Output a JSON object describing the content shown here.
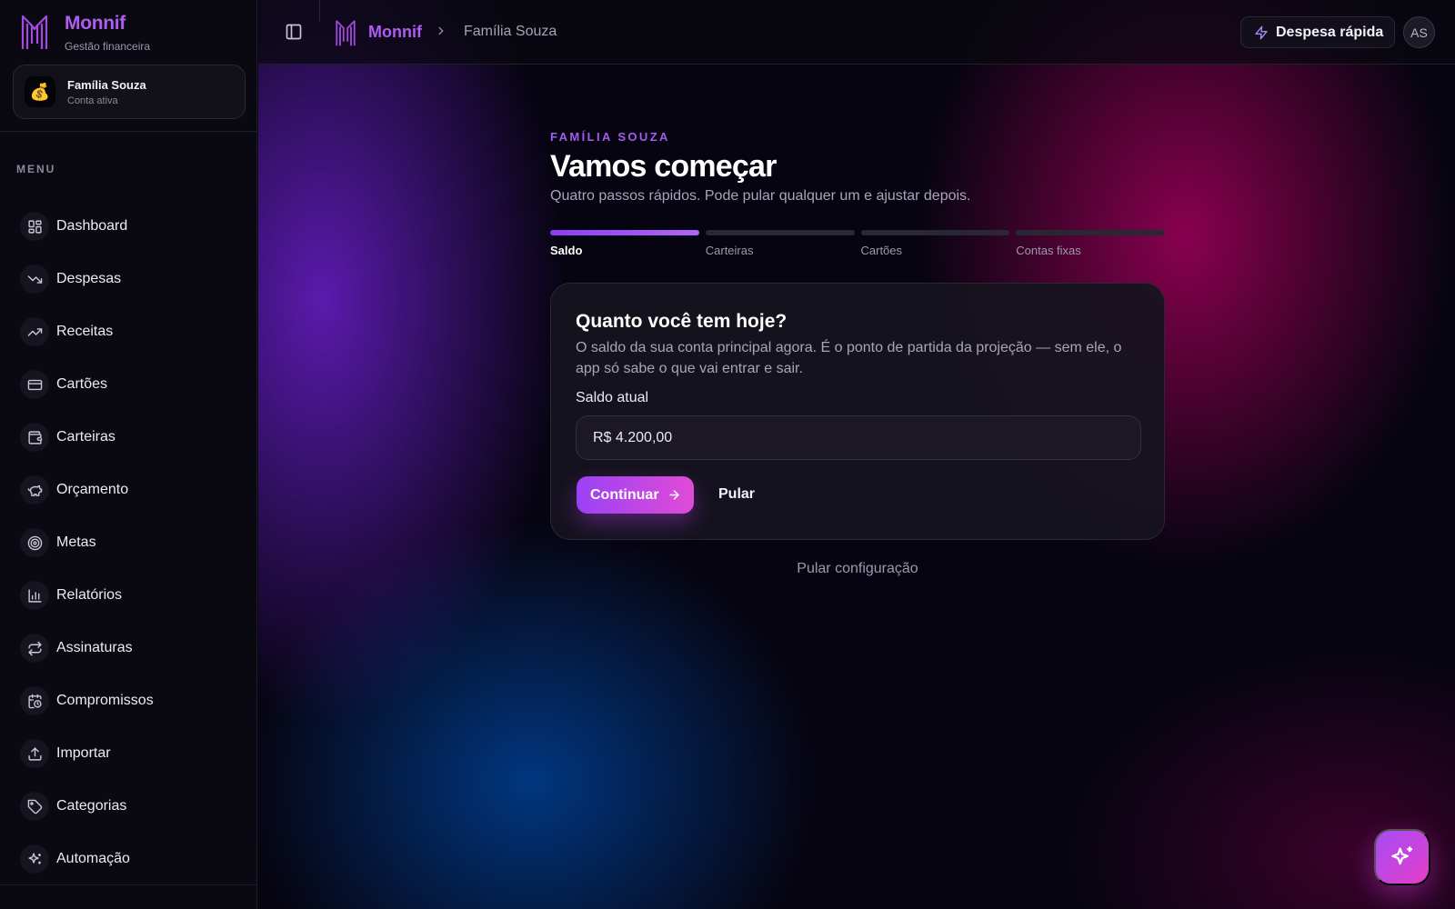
{
  "brand": {
    "name": "Monnif",
    "subtitle": "Gestão financeira"
  },
  "account": {
    "emoji": "💰",
    "name": "Família Souza",
    "status": "Conta ativa"
  },
  "menu": {
    "label": "MENU",
    "items": [
      {
        "label": "Dashboard",
        "icon": "grid-icon"
      },
      {
        "label": "Despesas",
        "icon": "trending-down-icon"
      },
      {
        "label": "Receitas",
        "icon": "trending-up-icon"
      },
      {
        "label": "Cartões",
        "icon": "credit-card-icon"
      },
      {
        "label": "Carteiras",
        "icon": "wallet-icon"
      },
      {
        "label": "Orçamento",
        "icon": "piggy-bank-icon"
      },
      {
        "label": "Metas",
        "icon": "target-icon"
      },
      {
        "label": "Relatórios",
        "icon": "bar-chart-icon"
      },
      {
        "label": "Assinaturas",
        "icon": "repeat-icon"
      },
      {
        "label": "Compromissos",
        "icon": "calendar-clock-icon"
      },
      {
        "label": "Importar",
        "icon": "upload-icon"
      },
      {
        "label": "Categorias",
        "icon": "tag-icon"
      },
      {
        "label": "Automação",
        "icon": "sparkles-icon"
      }
    ]
  },
  "topbar": {
    "breadcrumb_brand": "Monnif",
    "breadcrumb_current": "Família Souza",
    "quick_expense": "Despesa rápida",
    "user_initials": "AS"
  },
  "onboarding": {
    "eyebrow": "FAMÍLIA SOUZA",
    "title": "Vamos começar",
    "subtitle": "Quatro passos rápidos. Pode pular qualquer um e ajustar depois.",
    "steps": [
      {
        "label": "Saldo",
        "active": true
      },
      {
        "label": "Carteiras",
        "active": false
      },
      {
        "label": "Cartões",
        "active": false
      },
      {
        "label": "Contas fixas",
        "active": false
      }
    ],
    "card": {
      "title": "Quanto você tem hoje?",
      "description": "O saldo da sua conta principal agora. É o ponto de partida da projeção — sem ele, o app só sabe o que vai entrar e sair.",
      "field_label": "Saldo atual",
      "field_value": "R$ 4.200,00",
      "continue_label": "Continuar",
      "skip_label": "Pular"
    },
    "skip_setup": "Pular configuração"
  },
  "colors": {
    "accent": "#a25cf0",
    "accent_pink": "#e04bd6"
  }
}
